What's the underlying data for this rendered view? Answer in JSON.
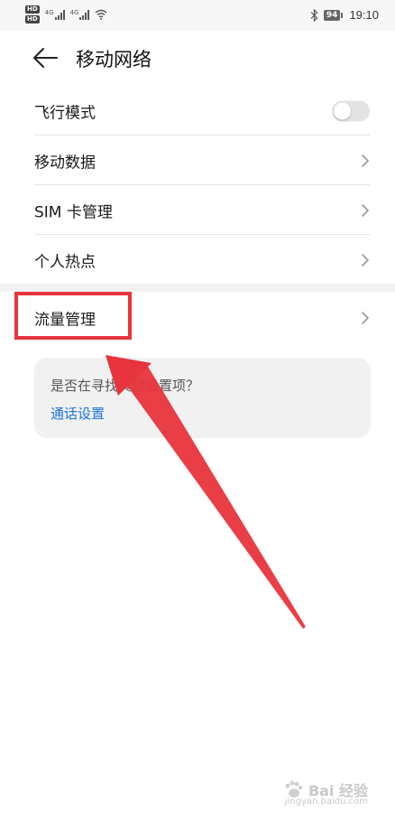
{
  "status_bar": {
    "network_a": "4G",
    "network_b": "4G",
    "battery": "94",
    "time": "19:10"
  },
  "header": {
    "title": "移动网络"
  },
  "settings": {
    "airplane_mode": "飞行模式",
    "airplane_mode_on": false,
    "mobile_data": "移动数据",
    "sim_management": "SIM 卡管理",
    "hotspot": "个人热点",
    "data_usage": "流量管理"
  },
  "suggestion": {
    "question": "是否在寻找其他设置项？",
    "link": "通话设置"
  },
  "watermark": {
    "text": "Bai 经验",
    "sub": "jingyan.baidu.com"
  },
  "colors": {
    "accent_link": "#1a73d9",
    "annotation_red": "#e8343c",
    "toggle_off": "#e3e3e3"
  }
}
